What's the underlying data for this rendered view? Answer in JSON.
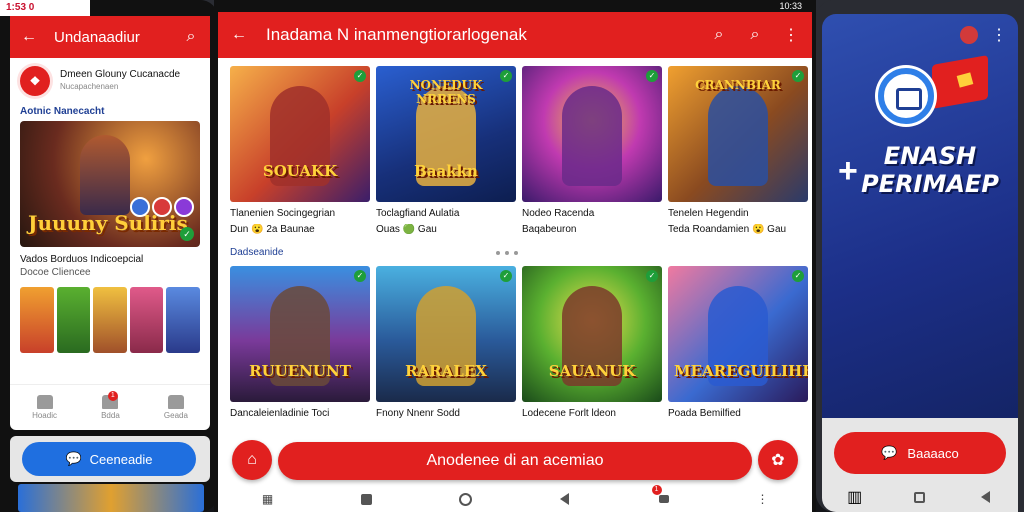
{
  "left_phone": {
    "status_time": "1:53 0",
    "appbar": {
      "title": "Undanaadiur",
      "back_icon": "arrow-left-icon",
      "search_icon": "search-icon"
    },
    "card_header": {
      "name": "Dmeen Glouny Cucanacde",
      "sub": "Nucapachenaen"
    },
    "section_title": "Aotnic Nanecacht",
    "hero_title": "Juuuny Suliris",
    "hero_badge": "✓",
    "item_text": {
      "title": "Vados Borduos Indicoepcial",
      "sub": "Docoe Cliencee"
    },
    "bottom_nav": [
      {
        "label": "Hoadic",
        "icon": "home-icon"
      },
      {
        "label": "Bdda",
        "icon": "notifications-icon",
        "badge": "1"
      },
      {
        "label": "Geada",
        "icon": "profile-icon"
      }
    ],
    "cta_label": "Ceeneadie"
  },
  "tablet": {
    "status": "10:33",
    "appbar": {
      "title": "Inadama N inanmengtiorarlogenak",
      "back_icon": "arrow-left-icon",
      "icons": [
        "search-icon",
        "search-icon",
        "more-vert-icon"
      ]
    },
    "row1": [
      {
        "name": "Tlanenien Socingegrian",
        "meta": "Dun 😮 2a Baunae",
        "banner": "SOUAKK",
        "bg": "linear-gradient(135deg,#f6b04a,#c8402a 55%,#3a1e6a)",
        "hero": "#a0302a"
      },
      {
        "name": "Toclagfiand Aulatia",
        "meta": "Ouas 🟢 Gau",
        "banner": "Baakkn",
        "bg": "linear-gradient(160deg,#2a5fd0,#17307a 60%,#0d1e50)",
        "hero": "#e8b040",
        "top_banner": "NONEDUK NRRENS"
      },
      {
        "name": "Nodeo Racenda",
        "meta": "Baqabeuron",
        "banner": "",
        "bg": "radial-gradient(circle at 50% 40%,#f0c040,#c03ab0 45%,#3a1a6a)",
        "hero": "#6a2a8a"
      },
      {
        "name": "Tenelen Hegendin",
        "meta": "Teda Roandamien 😮 Gau",
        "banner": "",
        "bg": "linear-gradient(135deg,#f0a030,#8a4a20 55%,#2a3a6a)",
        "hero": "#2a4fa0",
        "top_banner": "CRANNBIAR"
      }
    ],
    "section_title": "Dadseanide",
    "row2": [
      {
        "name": "Dancaleienladinie Toci",
        "banner": "RUUENUNT",
        "bg": "linear-gradient(180deg,#3a8fe0,#7a3a9a 55%,#2a1a3a)",
        "hero": "#6a4a3a"
      },
      {
        "name": "Fnony Nnenr Sodd",
        "banner": "RARALEX",
        "bg": "linear-gradient(180deg,#4ab0e0,#2a5a9a 55%,#1a2a4a)",
        "hero": "#d0a030"
      },
      {
        "name": "Lodecene Forlt ldeon",
        "banner": "SAUANUK",
        "bg": "radial-gradient(circle at 50% 40%,#f0e050,#5ab030 50%,#1a4a1a)",
        "hero": "#7a3a2a"
      },
      {
        "name": "Poada Bemilfied",
        "banner": "MEAREGUILIHE",
        "bg": "linear-gradient(135deg,#f07aa0,#3a6ad0 55%,#2a1a5a)",
        "hero": "#2a5ad0"
      }
    ],
    "cta_label": "Anodenee di an acemiao",
    "nav_badge": "1"
  },
  "right_phone": {
    "headline": "ENASH PERIMAEP",
    "button_label": "Baaaaco"
  },
  "colors": {
    "accent_red": "#e1201f",
    "accent_blue": "#1f6fe0",
    "section_blue": "#1f3f94"
  }
}
